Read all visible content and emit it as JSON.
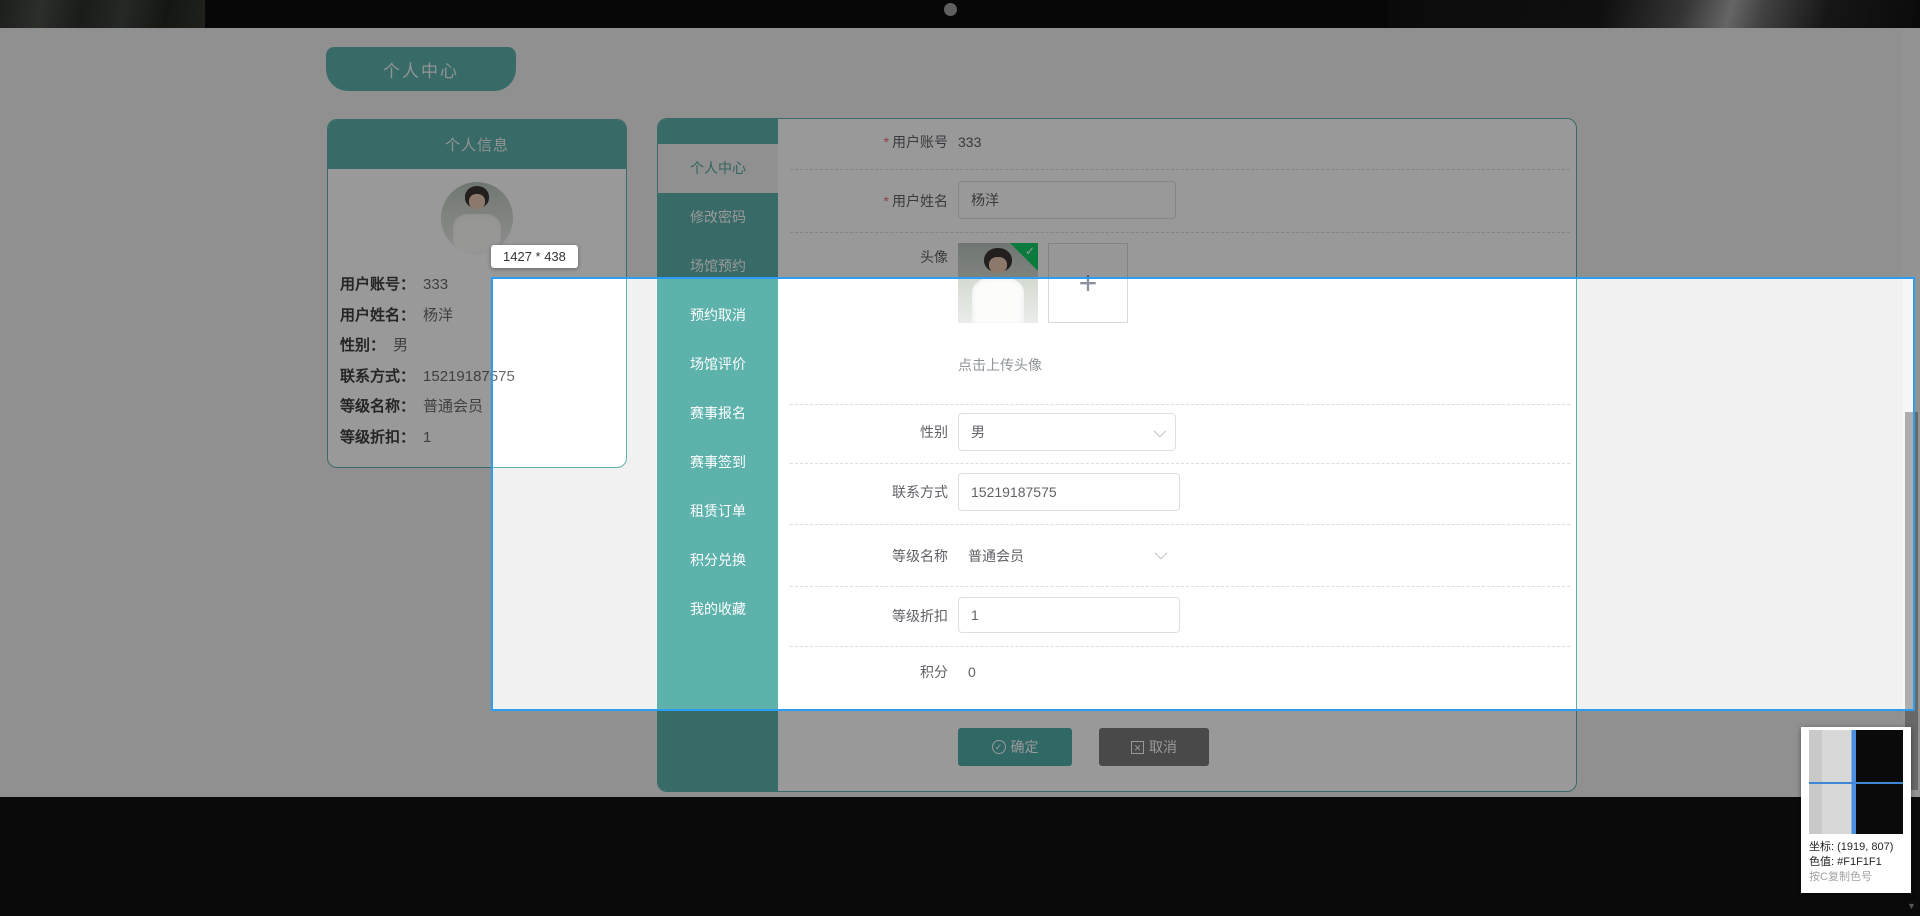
{
  "colors": {
    "accent_teal": "#5eb2ac",
    "page_bg": "#f1f1f1",
    "selection_blue": "#2b9df4",
    "confirm_green": "#4faea9",
    "cancel_gray": "#7b7b7b",
    "required_red": "#f56c6c",
    "badge_green": "#13ce66"
  },
  "icons": {
    "check": "✓",
    "close": "✕",
    "plus": "+",
    "arrow_down": "▼"
  },
  "header_tab": {
    "label": "个人中心"
  },
  "profile_card": {
    "title": "个人信息",
    "fields": [
      {
        "label": "用户账号：",
        "value": "333"
      },
      {
        "label": "用户姓名：",
        "value": "杨洋"
      },
      {
        "label": "性别：",
        "value": "男"
      },
      {
        "label": "联系方式：",
        "value": "15219187575"
      },
      {
        "label": "等级名称：",
        "value": "普通会员"
      },
      {
        "label": "等级折扣：",
        "value": "1"
      }
    ]
  },
  "dialog": {
    "menu": [
      {
        "label": "个人中心"
      },
      {
        "label": "修改密码"
      },
      {
        "label": "场馆预约"
      },
      {
        "label": "预约取消"
      },
      {
        "label": "场馆评价"
      },
      {
        "label": "赛事报名"
      },
      {
        "label": "赛事签到"
      },
      {
        "label": "租赁订单"
      },
      {
        "label": "积分兑换"
      },
      {
        "label": "我的收藏"
      }
    ],
    "form": {
      "required_mark": "*",
      "account": {
        "label": "用户账号",
        "value": "333"
      },
      "name": {
        "label": "用户姓名",
        "value": "杨洋"
      },
      "avatar": {
        "label": "头像",
        "hint": "点击上传头像"
      },
      "gender": {
        "label": "性别",
        "value": "男"
      },
      "phone": {
        "label": "联系方式",
        "value": "15219187575"
      },
      "level": {
        "label": "等级名称",
        "value": "普通会员"
      },
      "discount": {
        "label": "等级折扣",
        "value": "1"
      },
      "points": {
        "label": "积分",
        "value": "0"
      }
    },
    "footer": {
      "confirm": "确定",
      "cancel": "取消"
    }
  },
  "capture_tool": {
    "size_tooltip": "1427 * 438",
    "info_panel": {
      "coords": "坐标: (1919, 807)",
      "color": "色值: #F1F1F1",
      "hint": "按C复制色号"
    }
  }
}
